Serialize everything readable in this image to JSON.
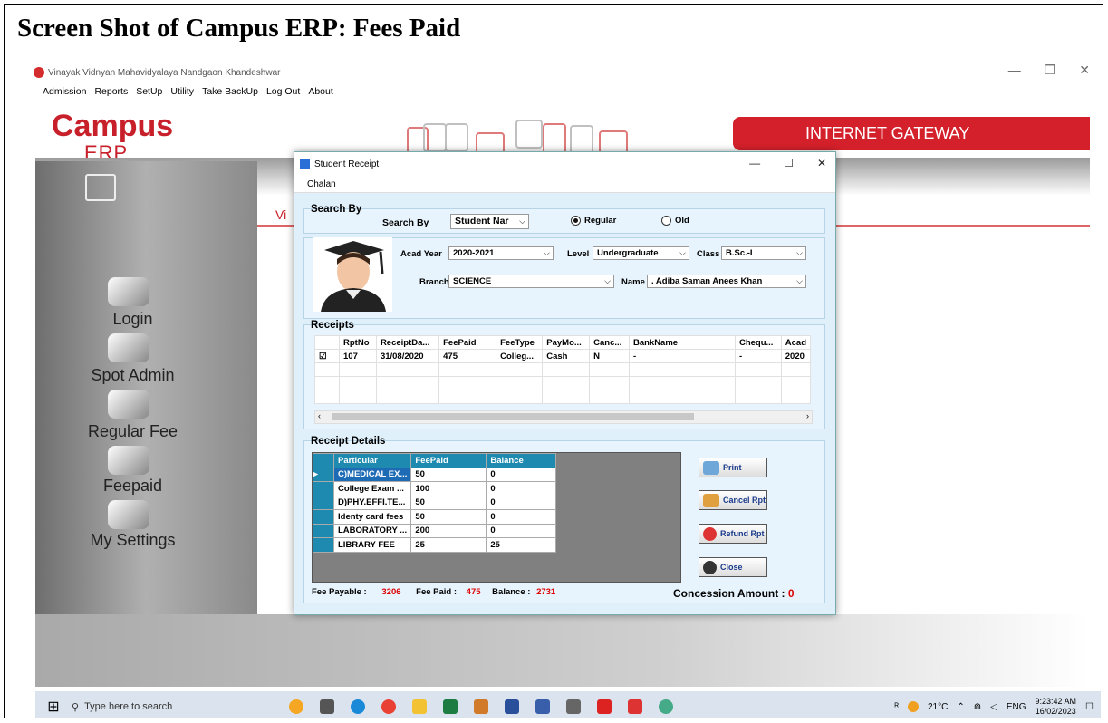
{
  "heading": "Screen Shot of  Campus ERP:  Fees Paid",
  "window_title": "Vinayak Vidnyan Mahavidyalaya Nandgaon Khandeshwar",
  "menu": [
    "Admission",
    "Reports",
    "SetUp",
    "Utility",
    "Take BackUp",
    "Log Out",
    "About"
  ],
  "logo": {
    "top": "Campus",
    "bottom": "ERP"
  },
  "gateway": "INTERNET GATEWAY",
  "vi_text": "Vi",
  "sidebar": [
    "Login",
    "Spot Admin",
    "Regular Fee",
    "Feepaid",
    "My Settings"
  ],
  "dialog": {
    "title": "Student Receipt",
    "menu": "Chalan",
    "search_group": "Search By",
    "search_label": "Search By",
    "search_value": "Student Nar",
    "radio_regular": "Regular",
    "radio_old": "Old",
    "acad_year_label": "Acad Year",
    "acad_year": "2020-2021",
    "level_label": "Level",
    "level": "Undergraduate",
    "class_label": "Class",
    "class": "B.Sc.-I",
    "branch_label": "Branch",
    "branch": "SCIENCE",
    "name_label": "Name",
    "name": ". Adiba Saman Anees Khan",
    "receipts_group": "Receipts",
    "receipts_headers": [
      "",
      "RptNo",
      "ReceiptDa...",
      "FeePaid",
      "FeeType",
      "PayMo...",
      "Canc...",
      "BankName",
      "Chequ...",
      "Acad"
    ],
    "receipts_row": [
      "☑",
      "107",
      "31/08/2020",
      "475",
      "Colleg...",
      "Cash",
      "N",
      "-",
      "-",
      "2020"
    ],
    "details_group": "Receipt Details",
    "details_headers": [
      "Particular",
      "FeePaid",
      "Balance"
    ],
    "details_rows": [
      [
        "C)MEDICAL EX...",
        "50",
        "0"
      ],
      [
        "College Exam ...",
        "100",
        "0"
      ],
      [
        "D)PHY.EFFI.TE...",
        "50",
        "0"
      ],
      [
        "Identy card fees",
        "50",
        "0"
      ],
      [
        "LABORATORY ...",
        "200",
        "0"
      ],
      [
        "LIBRARY FEE",
        "25",
        "25"
      ]
    ],
    "buttons": {
      "print": "Print",
      "cancel": "Cancel Rpt",
      "refund": "Refund Rpt",
      "close": "Close"
    },
    "fee_payable_label": "Fee Payable :",
    "fee_payable": "3206",
    "fee_paid_label": "Fee Paid :",
    "fee_paid": "475",
    "balance_label": "Balance :",
    "balance": "2731",
    "concession_label": "Concession Amount :",
    "concession": "0"
  },
  "taskbar": {
    "search": "Type here to search",
    "temp": "21°C",
    "lang": "ENG",
    "time": "9:23:42 AM",
    "date": "16/02/2023"
  }
}
